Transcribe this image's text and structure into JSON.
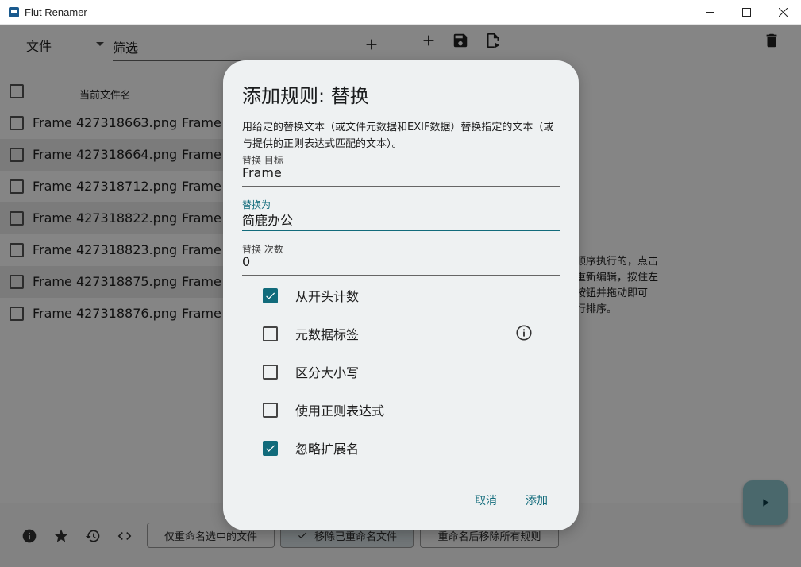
{
  "window": {
    "title": "Flut Renamer"
  },
  "toolbar": {
    "file_menu": "文件",
    "filter_placeholder": "筛选"
  },
  "list": {
    "header_current": "当前文件名",
    "rows": [
      {
        "name": "Frame 427318663.png",
        "new": "Frame"
      },
      {
        "name": "Frame 427318664.png",
        "new": "Frame"
      },
      {
        "name": "Frame 427318712.png",
        "new": "Frame"
      },
      {
        "name": "Frame 427318822.png",
        "new": "Frame"
      },
      {
        "name": "Frame 427318823.png",
        "new": "Frame"
      },
      {
        "name": "Frame 427318875.png",
        "new": "Frame"
      },
      {
        "name": "Frame 427318876.png",
        "new": "Frame"
      }
    ]
  },
  "rules_info": {
    "line1": "顺序执行的，点击",
    "line2": "重新编辑，按住左",
    "line3": "按钮并拖动即可",
    "line4": "行排序。"
  },
  "bottombar": {
    "btn_rename_selected": "仅重命名选中的文件",
    "btn_remove_renamed": "移除已重命名文件",
    "btn_remove_rules": "重命名后移除所有规则"
  },
  "dialog": {
    "title": "添加规则: 替换",
    "description": "用给定的替换文本（或文件元数据和EXIF数据）替换指定的文本（或与提供的正则表达式匹配的文本）。",
    "target_label": "替换 目标",
    "target_value": "Frame",
    "replace_label": "替换为",
    "replace_value": "简鹿办公",
    "count_label": "替换 次数",
    "count_value": "0",
    "options": {
      "from_start": "从开头计数",
      "metadata_tag": "元数据标签",
      "case_sensitive": "区分大小写",
      "use_regex": "使用正则表达式",
      "ignore_ext": "忽略扩展名"
    },
    "cancel": "取消",
    "add": "添加"
  },
  "colors": {
    "accent": "#116b7b",
    "fab": "#8fc7d0"
  }
}
